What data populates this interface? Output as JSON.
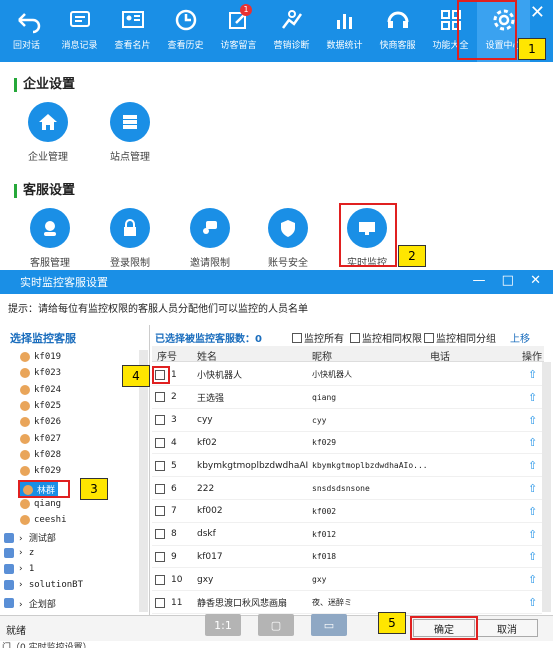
{
  "toolbar": {
    "items": [
      {
        "label": "回对话",
        "icon": "back-arrow-icon"
      },
      {
        "label": "消息记录",
        "icon": "message-icon"
      },
      {
        "label": "查看名片",
        "icon": "card-icon"
      },
      {
        "label": "查看历史",
        "icon": "clock-icon"
      },
      {
        "label": "访客留言",
        "icon": "edit-icon",
        "badge": "1"
      },
      {
        "label": "营销诊断",
        "icon": "chart-line-icon"
      },
      {
        "label": "数据统计",
        "icon": "bar-chart-icon"
      },
      {
        "label": "快商客服",
        "icon": "headset-icon"
      },
      {
        "label": "功能大全",
        "icon": "grid-icon"
      },
      {
        "label": "设置中心",
        "icon": "gear-icon"
      }
    ],
    "close": "✕"
  },
  "enterprise": {
    "title": "企业设置",
    "items": [
      {
        "label": "企业管理",
        "icon": "home-icon"
      },
      {
        "label": "站点管理",
        "icon": "site-icon"
      }
    ]
  },
  "service": {
    "title": "客服设置",
    "items": [
      {
        "label": "客服管理",
        "icon": "agent-icon"
      },
      {
        "label": "登录限制",
        "icon": "lock-icon"
      },
      {
        "label": "邀请限制",
        "icon": "invite-icon"
      },
      {
        "label": "账号安全",
        "icon": "shield-icon"
      },
      {
        "label": "实时监控",
        "icon": "monitor-icon"
      }
    ]
  },
  "callouts": [
    "1",
    "2",
    "3",
    "4",
    "5"
  ],
  "dialog": {
    "title": "实时监控客服设置",
    "controls": "— □ ✕",
    "tip": "提示：请给每位有监控权限的客服人员分配他们可以监控的人员名单",
    "left_title": "选择监控客服",
    "tree": [
      {
        "label": "kf019",
        "type": "agent"
      },
      {
        "label": "kf023",
        "type": "agent"
      },
      {
        "label": "kf024",
        "type": "agent"
      },
      {
        "label": "kf025",
        "type": "agent"
      },
      {
        "label": "kf026",
        "type": "agent"
      },
      {
        "label": "kf027",
        "type": "agent"
      },
      {
        "label": "kf028",
        "type": "agent"
      },
      {
        "label": "kf029",
        "type": "agent"
      },
      {
        "label": "林群",
        "type": "agent",
        "selected": true
      },
      {
        "label": "qiang",
        "type": "agent"
      },
      {
        "label": "ceeshi",
        "type": "agent"
      },
      {
        "label": "测试部",
        "type": "dept"
      },
      {
        "label": "z",
        "type": "dept"
      },
      {
        "label": "1",
        "type": "dept"
      },
      {
        "label": "solutionBT",
        "type": "dept"
      },
      {
        "label": "企划部",
        "type": "dept"
      }
    ],
    "right_title": "已选择被监控客服数：0",
    "options": [
      "监控所有",
      "监控相同权限",
      "监控相同分组"
    ],
    "move_up": "上移",
    "headers": {
      "no": "序号",
      "name": "姓名",
      "nick": "昵称",
      "phone": "电话",
      "op": "操作"
    },
    "rows": [
      {
        "no": "1",
        "name": "小快机器人",
        "nick": "小快机器人"
      },
      {
        "no": "2",
        "name": "王选强",
        "nick": "qiang"
      },
      {
        "no": "3",
        "name": "cyy",
        "nick": "cyy"
      },
      {
        "no": "4",
        "name": "kf02",
        "nick": "kf029"
      },
      {
        "no": "5",
        "name": "kbymkgtmoplbzdwdhaAI",
        "nick": "kbymkgtmoplbzdwdhaAIo..."
      },
      {
        "no": "6",
        "name": "222",
        "nick": "snsdsdsnsone"
      },
      {
        "no": "7",
        "name": "kf002",
        "nick": "kf002"
      },
      {
        "no": "8",
        "name": "dskf",
        "nick": "kf012"
      },
      {
        "no": "9",
        "name": "kf017",
        "nick": "kf018"
      },
      {
        "no": "10",
        "name": "gxy",
        "nick": "gxy"
      },
      {
        "no": "11",
        "name": "静香思渡口秋风悲画扇",
        "nick": "夜、迷醉ミ"
      }
    ],
    "status": "就绪",
    "status_btn_1": "1:1",
    "confirm": "确定",
    "cancel": "取消"
  },
  "footer_text": "门（0 实时监控设置）"
}
